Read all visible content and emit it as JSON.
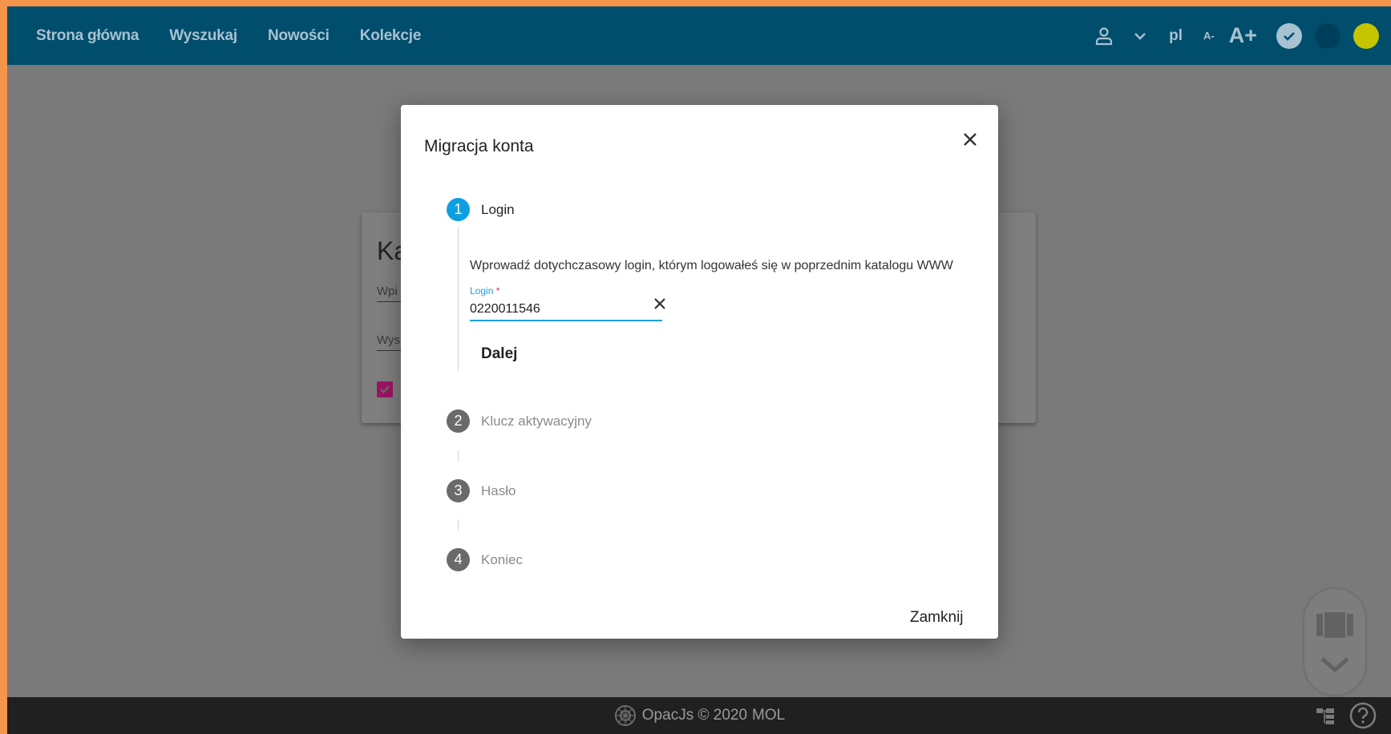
{
  "nav": {
    "links": [
      "Strona główna",
      "Wyszukaj",
      "Nowości",
      "Kolekcje"
    ],
    "lang": "pl",
    "font_small": "A-",
    "font_large": "A+",
    "theme_colors": [
      "#a7c2d1",
      "#003f5c",
      "#c5c400"
    ]
  },
  "background_card": {
    "title": "Ka",
    "field1": "Wpi",
    "field2": "Wys"
  },
  "modal": {
    "title": "Migracja konta",
    "steps": [
      {
        "num": "1",
        "label": "Login",
        "state": "active"
      },
      {
        "num": "2",
        "label": "Klucz aktywacyjny",
        "state": "inactive"
      },
      {
        "num": "3",
        "label": "Hasło",
        "state": "inactive"
      },
      {
        "num": "4",
        "label": "Koniec",
        "state": "inactive"
      }
    ],
    "description": "Wprowadź dotychczasowy login, którym logowałeś się w poprzednim katalogu WWW",
    "login_label": "Login",
    "login_required": "*",
    "login_value": "0220011546",
    "next_button": "Dalej",
    "close_button": "Zamknij"
  },
  "footer": {
    "text": "OpacJs © 2020",
    "brand": "MOL"
  },
  "colors": {
    "nav_bg": "#004d6c",
    "accent": "#0d9fe2",
    "frame": "#f5944b",
    "overlay": "#7a7a7a"
  }
}
